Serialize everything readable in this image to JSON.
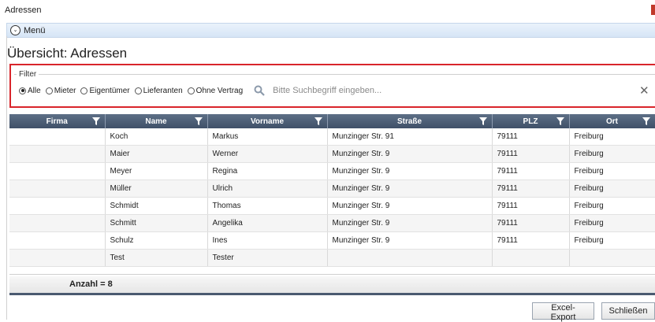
{
  "window": {
    "title": "Adressen"
  },
  "menu": {
    "label": "Menü"
  },
  "page": {
    "title": "Übersicht: Adressen"
  },
  "filter": {
    "legend": "Filter",
    "options": [
      "Alle",
      "Mieter",
      "Eigentümer",
      "Lieferanten",
      "Ohne Vertrag"
    ],
    "selected": "Alle",
    "search_placeholder": "Bitte Suchbegriff eingeben...",
    "search_value": ""
  },
  "table": {
    "columns": [
      "Firma",
      "Name",
      "Vorname",
      "Straße",
      "PLZ",
      "Ort"
    ],
    "rows": [
      [
        "",
        "Koch",
        "Markus",
        "Munzinger Str. 91",
        "79111",
        "Freiburg"
      ],
      [
        "",
        "Maier",
        "Werner",
        "Munzinger Str. 9",
        "79111",
        "Freiburg"
      ],
      [
        "",
        "Meyer",
        "Regina",
        "Munzinger Str. 9",
        "79111",
        "Freiburg"
      ],
      [
        "",
        "Müller",
        "Ulrich",
        "Munzinger Str. 9",
        "79111",
        "Freiburg"
      ],
      [
        "",
        "Schmidt",
        "Thomas",
        "Munzinger Str. 9",
        "79111",
        "Freiburg"
      ],
      [
        "",
        "Schmitt",
        "Angelika",
        "Munzinger Str. 9",
        "79111",
        "Freiburg"
      ],
      [
        "",
        "Schulz",
        "Ines",
        "Munzinger Str. 9",
        "79111",
        "Freiburg"
      ],
      [
        "",
        "Test",
        "Tester",
        "",
        "",
        ""
      ]
    ]
  },
  "summary": {
    "count_label": "Anzahl = 8"
  },
  "buttons": {
    "excel_export": "Excel-Export",
    "close": "Schließen"
  },
  "colors": {
    "accent_border": "#d9252b",
    "header_bg": "#4a5a70"
  }
}
